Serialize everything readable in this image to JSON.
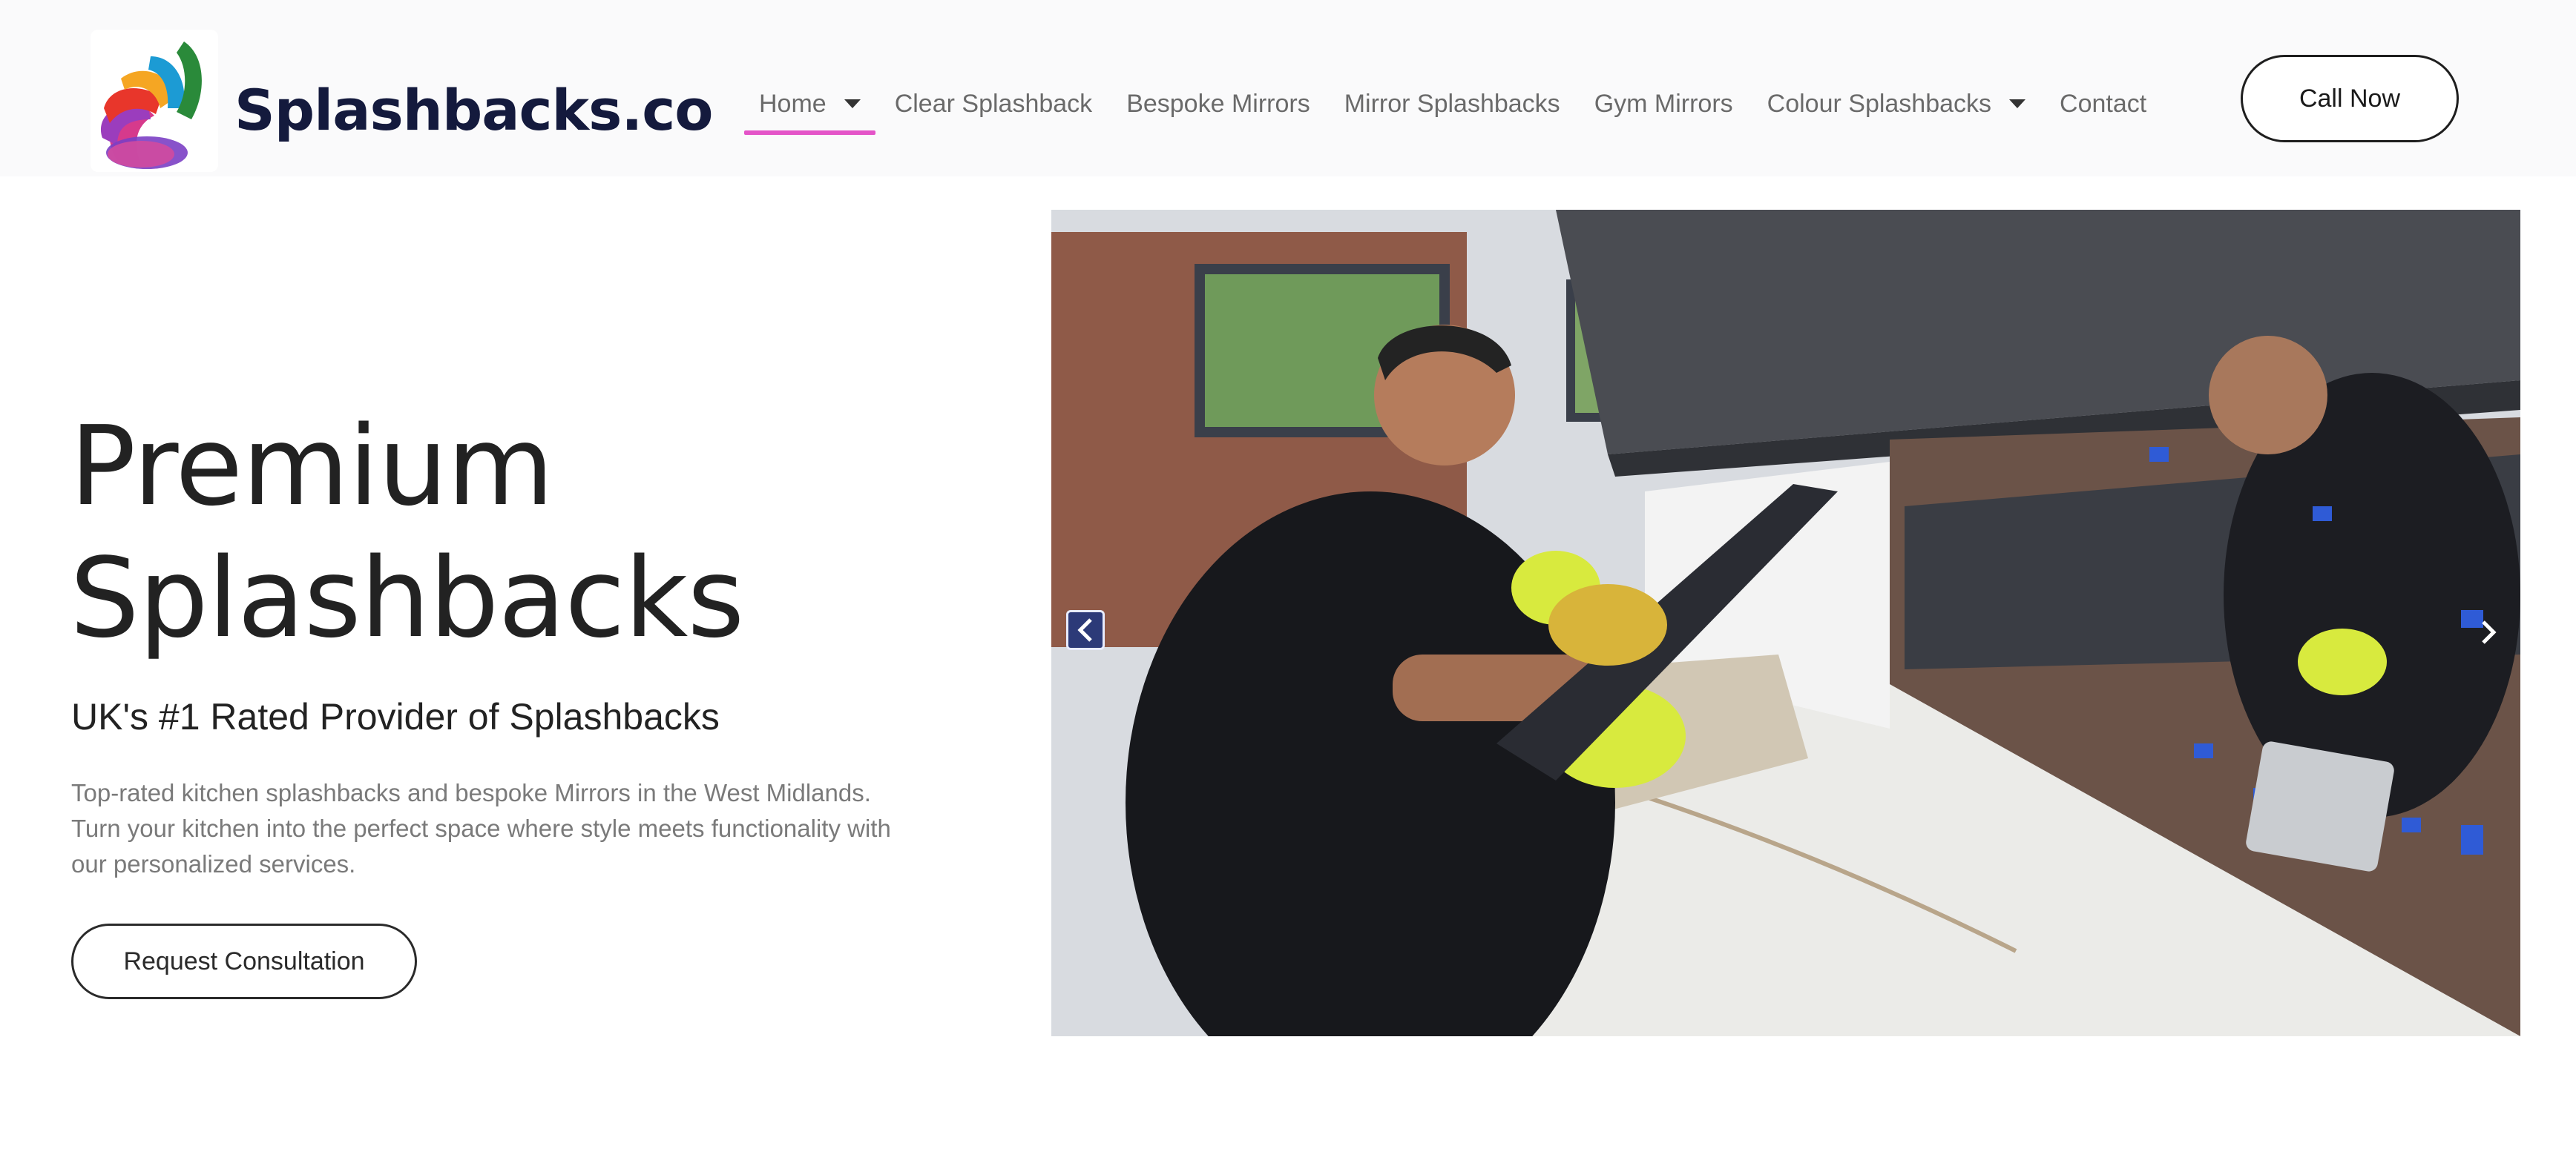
{
  "brand": {
    "name": "Splashbacks.co",
    "logo_colors": [
      "#2a8a3a",
      "#1c9bd4",
      "#f5a623",
      "#e8362b",
      "#9b3dbd",
      "#d63a8c"
    ]
  },
  "nav": {
    "items": [
      {
        "label": "Home",
        "has_dropdown": true,
        "active": true
      },
      {
        "label": "Clear Splashback",
        "has_dropdown": false
      },
      {
        "label": "Bespoke Mirrors",
        "has_dropdown": false
      },
      {
        "label": "Mirror Splashbacks",
        "has_dropdown": false
      },
      {
        "label": "Gym Mirrors",
        "has_dropdown": false
      },
      {
        "label": "Colour Splashbacks",
        "has_dropdown": true
      },
      {
        "label": "Contact",
        "has_dropdown": false
      }
    ],
    "active_underline_color": "#e454c8"
  },
  "header": {
    "call_button_label": "Call Now"
  },
  "hero": {
    "title_line1": "Premium",
    "title_line2": "Splashbacks",
    "subtitle": "UK's #1 Rated Provider of Splashbacks",
    "description": "Top-rated kitchen splashbacks and bespoke Mirrors in the West Midlands. Turn your kitchen into the perfect space where style meets functionality with our personalized services.",
    "cta_label": "Request Consultation"
  },
  "slider": {
    "prev_icon": "chevron-left-icon",
    "next_icon": "chevron-right-icon"
  }
}
